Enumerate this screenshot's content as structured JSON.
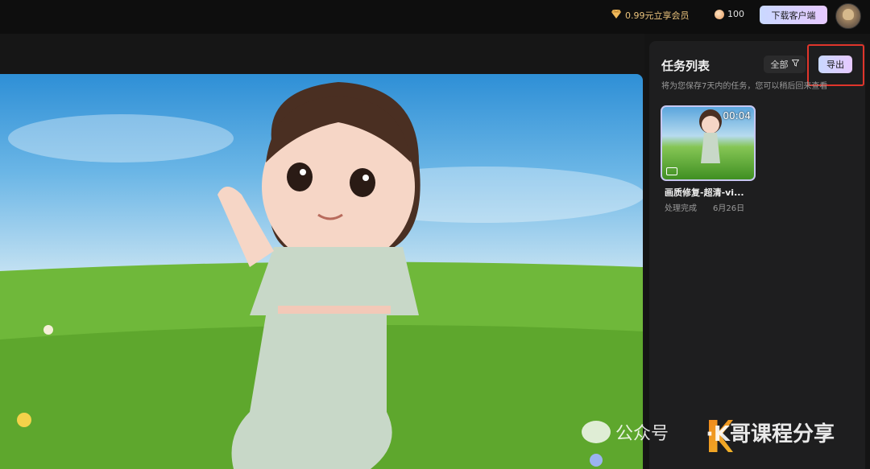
{
  "topbar": {
    "promo_label": "0.99元立享会员",
    "coins": "100",
    "download_label": "下载客户端"
  },
  "panel": {
    "title": "任务列表",
    "filter_label": "全部",
    "export_label": "导出",
    "subtitle": "将为您保存7天内的任务，您可以稍后回来查看"
  },
  "task": {
    "duration": "00:04",
    "name": "画质修复-超清-vi...",
    "status": "处理完成",
    "date": "6月26日"
  },
  "watermark": {
    "account_label": "公众号",
    "brand": "·K哥课程分享"
  },
  "colors": {
    "accent_gradient_start": "#c9d8ff",
    "accent_gradient_end": "#e7c9ff",
    "highlight_box": "#e0352b",
    "promo_text": "#e9c27c"
  }
}
